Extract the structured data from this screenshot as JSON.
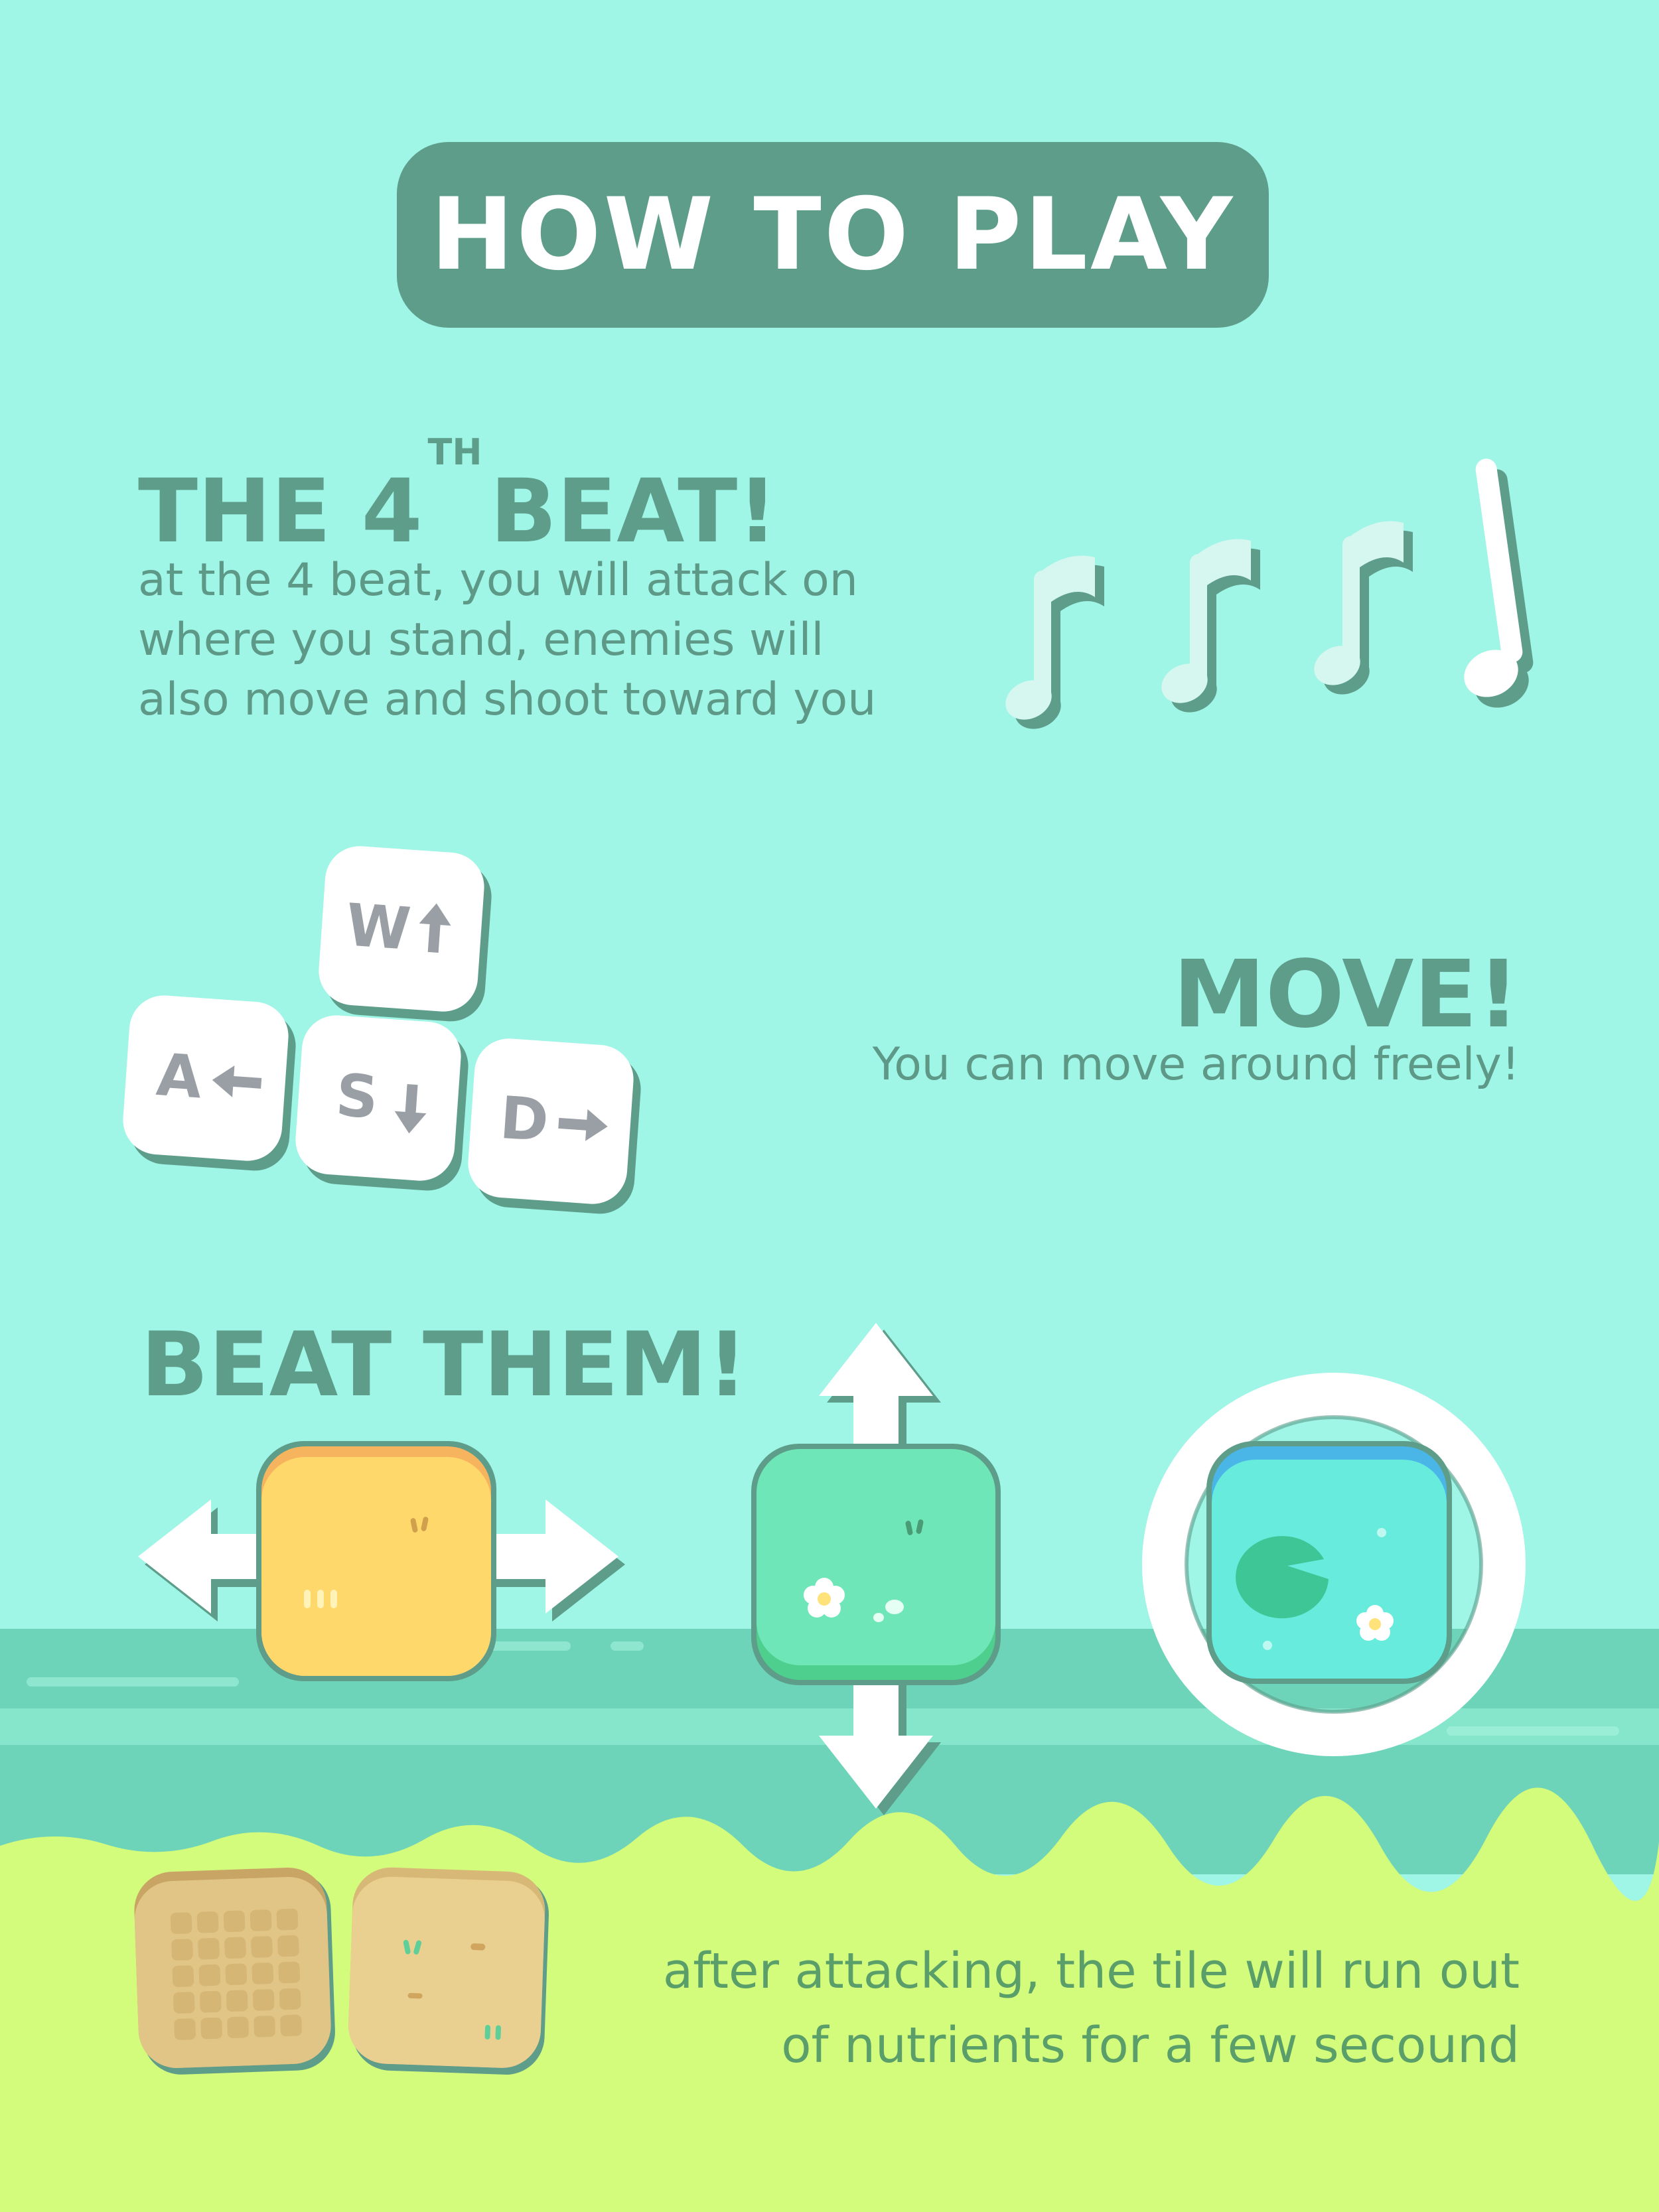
{
  "title": "HOW TO PLAY",
  "beat": {
    "heading_prefix": "THE 4",
    "heading_sup": "TH",
    "heading_suffix": "BEAT!",
    "lines": [
      "at the 4  beat, you will attack on",
      "where you stand, enemies will",
      "also move and shoot toward you"
    ]
  },
  "move": {
    "heading": "MOVE!",
    "text": "You can move around freely!",
    "keys": [
      {
        "letter": "W",
        "arrow": "up"
      },
      {
        "letter": "A",
        "arrow": "left"
      },
      {
        "letter": "S",
        "arrow": "down"
      },
      {
        "letter": "D",
        "arrow": "right"
      }
    ]
  },
  "beat_them": {
    "heading": "BEAT THEM!"
  },
  "soil": {
    "lines": [
      "after attacking, the tile will run out",
      "of nutrients for a few secound"
    ]
  },
  "colors": {
    "background": "#9ff5e6",
    "accent": "#5d9d8a",
    "grass": "#d3fb7c",
    "river": "#6dd4ba",
    "enemy_yellow": "#ffd86b",
    "enemy_green": "#6fe6b8",
    "enemy_cyan": "#66ebdc",
    "depleted_tile": "#e0c587"
  },
  "icons": [
    "music-note-icon",
    "keyboard-key-w",
    "keyboard-key-a",
    "keyboard-key-s",
    "keyboard-key-d",
    "arrow-horizontal-icon",
    "arrow-vertical-icon",
    "ring-icon",
    "lily-pad-icon",
    "flower-icon"
  ]
}
